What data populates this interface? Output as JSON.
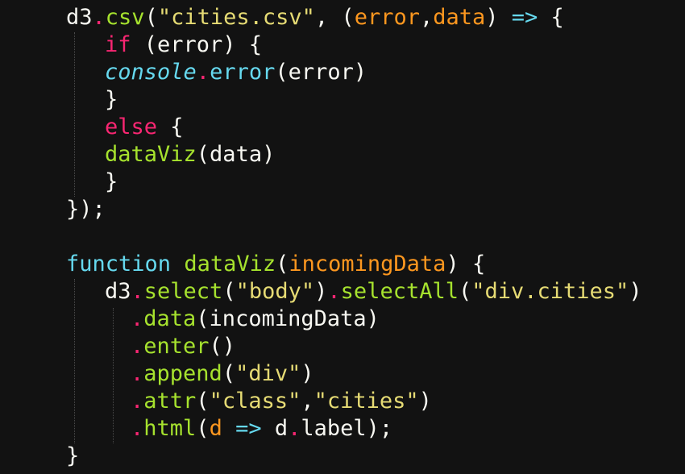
{
  "editor": {
    "theme": {
      "background": "#121212",
      "text": "#f8f8f2",
      "method": "#a6e22e",
      "keyword": "#f92672",
      "string": "#e6db74",
      "parameter": "#fd971f",
      "storage": "#66d9ef"
    },
    "lines": [
      [
        {
          "t": "d3",
          "c": "plain"
        },
        {
          "t": ".",
          "c": "punct"
        },
        {
          "t": "csv",
          "c": "method"
        },
        {
          "t": "(",
          "c": "plain"
        },
        {
          "t": "\"cities.csv\"",
          "c": "string"
        },
        {
          "t": ", (",
          "c": "plain"
        },
        {
          "t": "error",
          "c": "param"
        },
        {
          "t": ",",
          "c": "plain"
        },
        {
          "t": "data",
          "c": "param"
        },
        {
          "t": ") ",
          "c": "plain"
        },
        {
          "t": "=>",
          "c": "arrow"
        },
        {
          "t": " {",
          "c": "plain"
        }
      ],
      [
        {
          "t": "if",
          "c": "keyword"
        },
        {
          "t": " (error) {",
          "c": "plain"
        }
      ],
      [
        {
          "t": "console",
          "c": "builtin"
        },
        {
          "t": ".",
          "c": "punct"
        },
        {
          "t": "error",
          "c": "storage"
        },
        {
          "t": "(error)",
          "c": "plain"
        }
      ],
      [
        {
          "t": "}",
          "c": "plain"
        }
      ],
      [
        {
          "t": "else",
          "c": "keyword"
        },
        {
          "t": " {",
          "c": "plain"
        }
      ],
      [
        {
          "t": "dataViz",
          "c": "method"
        },
        {
          "t": "(data)",
          "c": "plain"
        }
      ],
      [
        {
          "t": "}",
          "c": "plain"
        }
      ],
      [
        {
          "t": "});",
          "c": "plain"
        }
      ],
      [],
      [
        {
          "t": "function",
          "c": "storage"
        },
        {
          "t": " ",
          "c": "plain"
        },
        {
          "t": "dataViz",
          "c": "method"
        },
        {
          "t": "(",
          "c": "plain"
        },
        {
          "t": "incomingData",
          "c": "param"
        },
        {
          "t": ") {",
          "c": "plain"
        }
      ],
      [
        {
          "t": "d3",
          "c": "plain"
        },
        {
          "t": ".",
          "c": "punct"
        },
        {
          "t": "select",
          "c": "method"
        },
        {
          "t": "(",
          "c": "plain"
        },
        {
          "t": "\"body\"",
          "c": "string"
        },
        {
          "t": ")",
          "c": "plain"
        },
        {
          "t": ".",
          "c": "punct"
        },
        {
          "t": "selectAll",
          "c": "method"
        },
        {
          "t": "(",
          "c": "plain"
        },
        {
          "t": "\"div.cities\"",
          "c": "string"
        },
        {
          "t": ")",
          "c": "plain"
        }
      ],
      [
        {
          "t": ".",
          "c": "punct"
        },
        {
          "t": "data",
          "c": "method"
        },
        {
          "t": "(incomingData)",
          "c": "plain"
        }
      ],
      [
        {
          "t": ".",
          "c": "punct"
        },
        {
          "t": "enter",
          "c": "method"
        },
        {
          "t": "()",
          "c": "plain"
        }
      ],
      [
        {
          "t": ".",
          "c": "punct"
        },
        {
          "t": "append",
          "c": "method"
        },
        {
          "t": "(",
          "c": "plain"
        },
        {
          "t": "\"div\"",
          "c": "string"
        },
        {
          "t": ")",
          "c": "plain"
        }
      ],
      [
        {
          "t": ".",
          "c": "punct"
        },
        {
          "t": "attr",
          "c": "method"
        },
        {
          "t": "(",
          "c": "plain"
        },
        {
          "t": "\"class\"",
          "c": "string"
        },
        {
          "t": ",",
          "c": "plain"
        },
        {
          "t": "\"cities\"",
          "c": "string"
        },
        {
          "t": ")",
          "c": "plain"
        }
      ],
      [
        {
          "t": ".",
          "c": "punct"
        },
        {
          "t": "html",
          "c": "method"
        },
        {
          "t": "(",
          "c": "plain"
        },
        {
          "t": "d",
          "c": "param"
        },
        {
          "t": " ",
          "c": "plain"
        },
        {
          "t": "=>",
          "c": "arrow"
        },
        {
          "t": " d",
          "c": "plain"
        },
        {
          "t": ".",
          "c": "punct"
        },
        {
          "t": "label);",
          "c": "plain"
        }
      ],
      [
        {
          "t": "}",
          "c": "plain"
        }
      ]
    ]
  }
}
